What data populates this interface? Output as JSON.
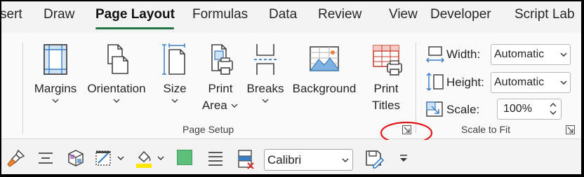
{
  "tabs": [
    {
      "label": "sert",
      "active": false
    },
    {
      "label": "Draw",
      "active": false
    },
    {
      "label": "Page Layout",
      "active": true
    },
    {
      "label": "Formulas",
      "active": false
    },
    {
      "label": "Data",
      "active": false
    },
    {
      "label": "Review",
      "active": false
    },
    {
      "label": "View",
      "active": false
    },
    {
      "label": "Developer",
      "active": false
    },
    {
      "label": "Script Lab",
      "active": false
    }
  ],
  "page_setup": {
    "group_label": "Page Setup",
    "margins": {
      "label": "Margins",
      "icon": "margins-icon"
    },
    "orientation": {
      "label": "Orientation",
      "icon": "orientation-icon"
    },
    "size": {
      "label": "Size",
      "icon": "size-icon"
    },
    "print_area": {
      "label1": "Print",
      "label2": "Area",
      "icon": "print-area-icon"
    },
    "breaks": {
      "label": "Breaks",
      "icon": "breaks-icon"
    },
    "background": {
      "label": "Background",
      "icon": "background-image-icon"
    },
    "print_titles": {
      "label1": "Print",
      "label2": "Titles",
      "icon": "print-titles-icon"
    }
  },
  "scale_to_fit": {
    "group_label": "Scale to Fit",
    "width": {
      "label": "Width:",
      "value": "Automatic"
    },
    "height": {
      "label": "Height:",
      "value": "Automatic"
    },
    "scale": {
      "label": "Scale:",
      "value": "100%"
    }
  },
  "quick_toolbar": {
    "font_name": "Calibri"
  },
  "colors": {
    "accent": "#217346",
    "annotation": "#e0161b",
    "fill_green": "#5cbf7a",
    "highlight_yellow": "#ffe600"
  }
}
